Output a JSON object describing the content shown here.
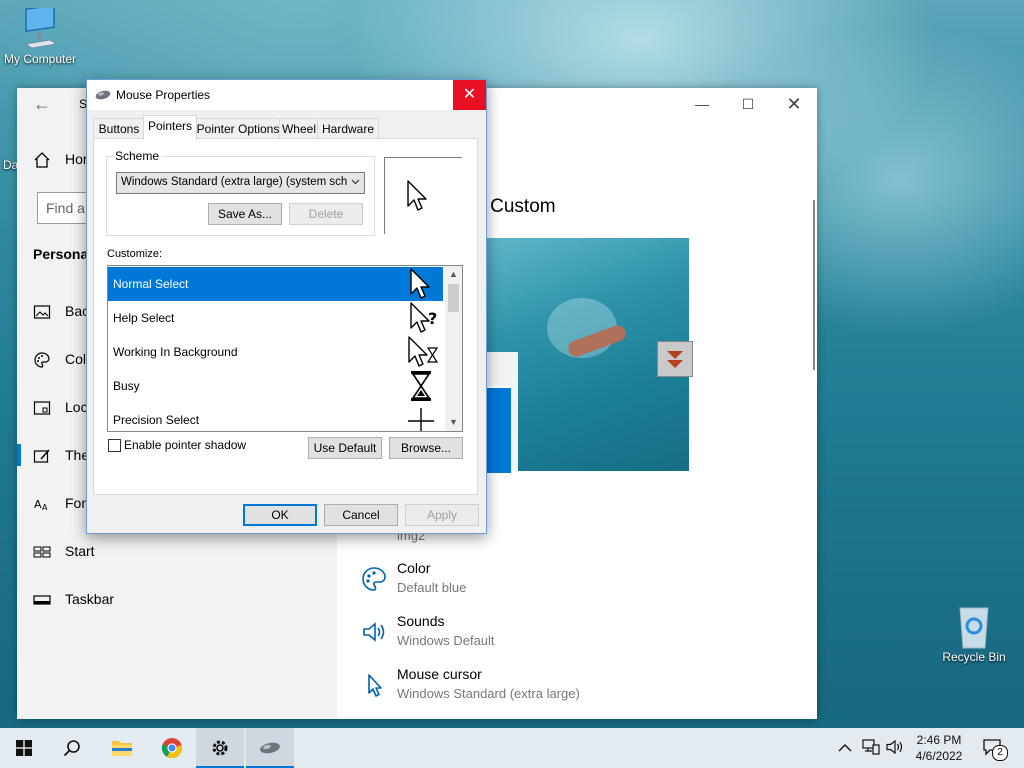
{
  "desktop": {
    "my_computer": "My Computer",
    "recycle_bin": "Recycle Bin",
    "clipped_label": "Da"
  },
  "settings": {
    "title_initial": "S",
    "search_placeholder": "Find a",
    "home": "Hor",
    "section": "Personal",
    "nav": [
      "Bac",
      "Col",
      "Loc",
      "The",
      "Fon",
      "Start",
      "Taskbar"
    ],
    "theme_heading": "e: Custom",
    "rows": [
      {
        "title": "",
        "subtitle": "img2"
      },
      {
        "title": "Color",
        "subtitle": "Default blue"
      },
      {
        "title": "Sounds",
        "subtitle": "Windows Default"
      },
      {
        "title": "Mouse cursor",
        "subtitle": "Windows Standard (extra large)"
      }
    ]
  },
  "dialog": {
    "title": "Mouse Properties",
    "tabs": [
      "Buttons",
      "Pointers",
      "Pointer Options",
      "Wheel",
      "Hardware"
    ],
    "active_tab": "Pointers",
    "scheme_group": "Scheme",
    "scheme_value": "Windows Standard (extra large) (system scheme",
    "save_as": "Save As...",
    "delete": "Delete",
    "customize_label": "Customize:",
    "pointers": [
      "Normal Select",
      "Help Select",
      "Working In Background",
      "Busy",
      "Precision Select"
    ],
    "selected_pointer": "Normal Select",
    "enable_shadow": "Enable pointer shadow",
    "use_default": "Use Default",
    "browse": "Browse...",
    "ok": "OK",
    "cancel": "Cancel",
    "apply": "Apply"
  },
  "taskbar": {
    "time": "2:46 PM",
    "date": "4/6/2022",
    "notifications": "2"
  },
  "colors": {
    "accent": "#0078d7",
    "close_red": "#e81123"
  }
}
